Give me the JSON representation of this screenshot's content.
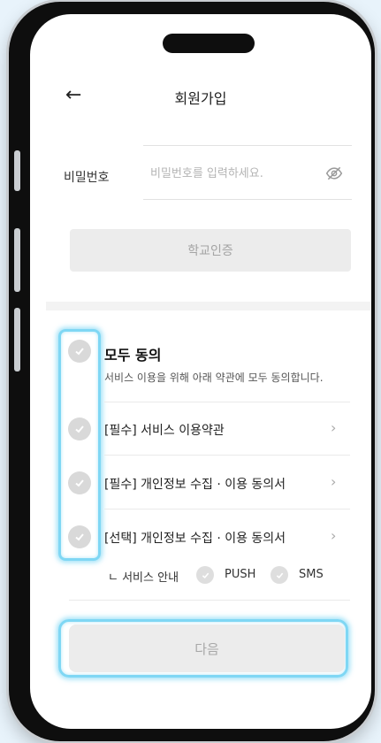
{
  "header": {
    "back_icon": "←",
    "title": "회원가입"
  },
  "password": {
    "label": "비밀번호",
    "placeholder": "비밀번호를 입력하세요.",
    "value": "",
    "toggle_icon": "eye-off-icon"
  },
  "school_verify_label": "학교인증",
  "agreements": {
    "all_title": "모두 동의",
    "all_description": "서비스 이용을 위해 아래 약관에 모두 동의합니다.",
    "items": [
      {
        "label": "[필수] 서비스 이용약관"
      },
      {
        "label": "[필수] 개인정보 수집 · 이용 동의서"
      },
      {
        "label": "[선택] 개인정보 수집 · 이용 동의서"
      }
    ],
    "chevron": "›",
    "service_notice": {
      "prefix": "ㄴ 서비스 안내",
      "options": [
        "PUSH",
        "SMS"
      ]
    }
  },
  "next_label": "다음",
  "colors": {
    "highlight": "#7fd7f4",
    "disabled_bg": "#ececec",
    "disabled_text": "#a8a8a8"
  }
}
